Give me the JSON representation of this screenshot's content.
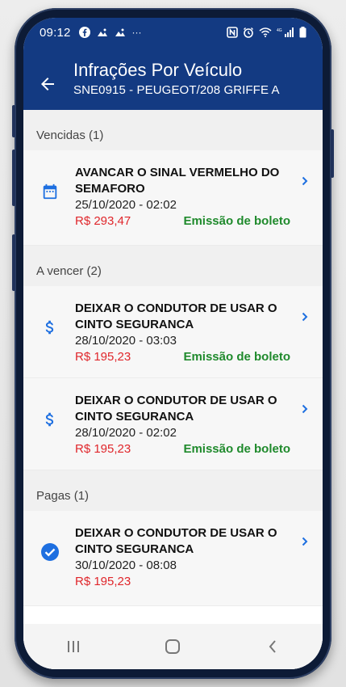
{
  "status_bar": {
    "time": "09:12",
    "left_icons": [
      "facebook-icon",
      "image-icon",
      "image-icon",
      "more-icon"
    ],
    "right_icons": [
      "nfc-icon",
      "alarm-icon",
      "wifi-icon",
      "4g-signal-icon",
      "battery-icon"
    ]
  },
  "header": {
    "title": "Infrações Por Veículo",
    "subtitle": "SNE0915 - PEUGEOT/208 GRIFFE A",
    "background_color": "#133a82"
  },
  "sections": [
    {
      "label": "Vencidas (1)",
      "items": [
        {
          "icon": "calendar-icon",
          "description": "AVANCAR O SINAL VERMELHO DO SEMAFORO",
          "datetime": "25/10/2020 - 02:02",
          "amount": "R$ 293,47",
          "action": "Emissão de boleto"
        }
      ]
    },
    {
      "label": "A vencer (2)",
      "items": [
        {
          "icon": "dollar-icon",
          "description": "DEIXAR O CONDUTOR DE USAR O CINTO SEGURANCA",
          "datetime": "28/10/2020 - 03:03",
          "amount": "R$ 195,23",
          "action": "Emissão de boleto"
        },
        {
          "icon": "dollar-icon",
          "description": "DEIXAR O CONDUTOR DE USAR O CINTO SEGURANCA",
          "datetime": "28/10/2020 - 02:02",
          "amount": "R$ 195,23",
          "action": "Emissão de boleto"
        }
      ]
    },
    {
      "label": "Pagas (1)",
      "items": [
        {
          "icon": "check-circle-icon",
          "description": "DEIXAR O CONDUTOR DE USAR O CINTO SEGURANCA",
          "datetime": "30/10/2020 - 08:08",
          "amount": "R$ 195,23",
          "action": ""
        }
      ]
    }
  ],
  "colors": {
    "accent_blue": "#1e6fe0",
    "amount_red": "#e0262b",
    "action_green": "#1f8a2c"
  },
  "nav_bar": {
    "buttons": [
      "recent-apps-icon",
      "home-icon",
      "back-icon"
    ]
  }
}
